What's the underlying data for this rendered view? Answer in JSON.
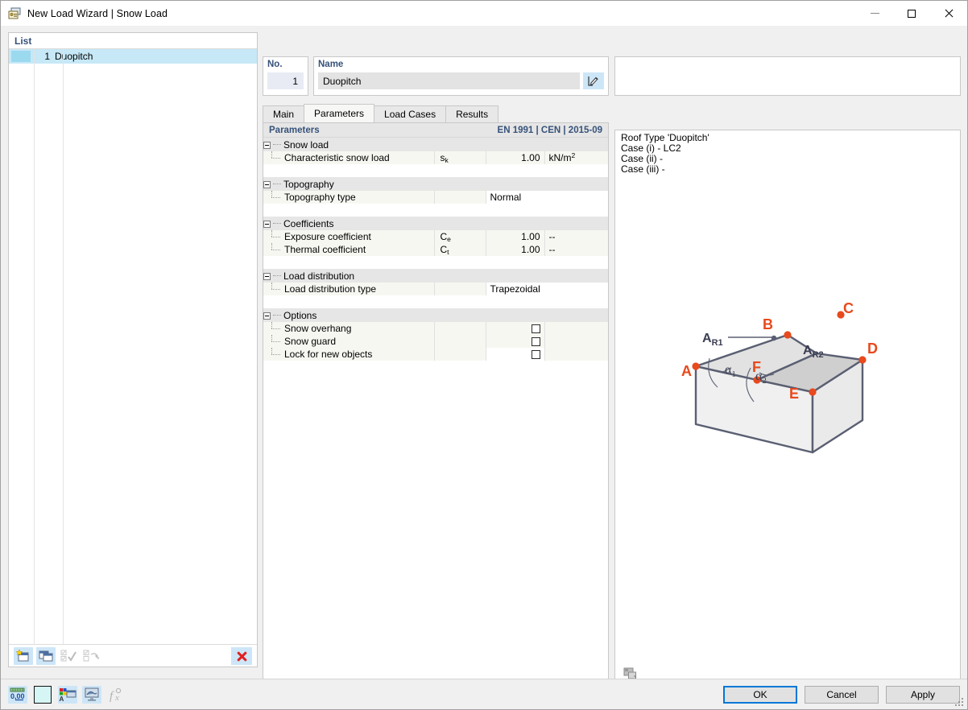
{
  "window": {
    "title": "New Load Wizard | Snow Load",
    "app_icon": "load-wizard-icon",
    "minimize_label": "Minimize",
    "maximize_label": "Maximize",
    "close_label": "Close"
  },
  "left_panel": {
    "header": "List",
    "rows": [
      {
        "no": "1",
        "name": "Duopitch",
        "selected": true
      }
    ],
    "toolbar": [
      {
        "name": "new-item-button",
        "label": "New",
        "enabled": true
      },
      {
        "name": "copy-item-button",
        "label": "Copy",
        "enabled": true
      },
      {
        "name": "select-all-button",
        "label": "Select All",
        "enabled": false
      },
      {
        "name": "invert-selection-button",
        "label": "Invert Selection",
        "enabled": false
      },
      {
        "name": "delete-item-button",
        "label": "Delete",
        "enabled": true
      }
    ]
  },
  "header_fields": {
    "no_label": "No.",
    "no_value": "1",
    "name_label": "Name",
    "name_value": "Duopitch",
    "name_edit_button": "edit-name-icon"
  },
  "tabs": [
    {
      "label": "Main",
      "selected": false
    },
    {
      "label": "Parameters",
      "selected": true
    },
    {
      "label": "Load Cases",
      "selected": false
    },
    {
      "label": "Results",
      "selected": false
    }
  ],
  "parameters": {
    "header_left": "Parameters",
    "header_right": "EN 1991 | CEN | 2015-09",
    "groups": [
      {
        "title": "Snow load",
        "rows": [
          {
            "name": "Characteristic snow load",
            "symbol": "s",
            "symbol_sub": "k",
            "value": "1.00",
            "unit": "kN/m",
            "unit_sup": "2",
            "type": "value"
          }
        ]
      },
      {
        "title": "Topography",
        "rows": [
          {
            "name": "Topography type",
            "symbol": "",
            "symbol_sub": "",
            "value": "Normal",
            "unit": "",
            "unit_sup": "",
            "type": "text"
          }
        ]
      },
      {
        "title": "Coefficients",
        "rows": [
          {
            "name": "Exposure coefficient",
            "symbol": "C",
            "symbol_sub": "e",
            "value": "1.00",
            "unit": "--",
            "unit_sup": "",
            "type": "value"
          },
          {
            "name": "Thermal coefficient",
            "symbol": "C",
            "symbol_sub": "t",
            "value": "1.00",
            "unit": "--",
            "unit_sup": "",
            "type": "value"
          }
        ]
      },
      {
        "title": "Load distribution",
        "rows": [
          {
            "name": "Load distribution type",
            "symbol": "",
            "symbol_sub": "",
            "value": "Trapezoidal",
            "unit": "",
            "unit_sup": "",
            "type": "text"
          }
        ]
      },
      {
        "title": "Options",
        "rows": [
          {
            "name": "Snow overhang",
            "symbol": "",
            "symbol_sub": "",
            "value": "",
            "unit": "",
            "unit_sup": "",
            "type": "checkbox",
            "checked": false
          },
          {
            "name": "Snow guard",
            "symbol": "",
            "symbol_sub": "",
            "value": "",
            "unit": "",
            "unit_sup": "",
            "type": "checkbox",
            "checked": false
          },
          {
            "name": "Lock for new objects",
            "symbol": "",
            "symbol_sub": "",
            "value": "",
            "unit": "",
            "unit_sup": "",
            "type": "checkbox",
            "checked": false,
            "active": true
          }
        ]
      }
    ]
  },
  "preview": {
    "info_text": "Roof Type 'Duopitch'\nCase (i) - LC2\nCase (ii) -\nCase (iii) -",
    "tool_icon": "image-export-icon",
    "figure": {
      "title": "duopitch-roof-diagram",
      "vertex_labels": [
        "A",
        "B",
        "C",
        "D",
        "E",
        "F"
      ],
      "area_labels": [
        "A_R1",
        "A_R2"
      ],
      "angle_labels": [
        "α₁",
        "α₂"
      ],
      "colors": {
        "vertex": "#e8491d",
        "edge": "#5a5f72",
        "face_light": "#f0f0f0",
        "face_mid": "#e2e2e2",
        "face_dark": "#cfcfcf"
      }
    }
  },
  "status_icons": [
    {
      "name": "numeric-display-icon",
      "enabled": true
    },
    {
      "name": "color-swatch-icon",
      "enabled": true
    },
    {
      "name": "render-settings-icon",
      "enabled": true
    },
    {
      "name": "display-monitor-icon",
      "enabled": true
    },
    {
      "name": "function-editor-icon",
      "enabled": false
    }
  ],
  "buttons": {
    "ok": "OK",
    "cancel": "Cancel",
    "apply": "Apply"
  }
}
